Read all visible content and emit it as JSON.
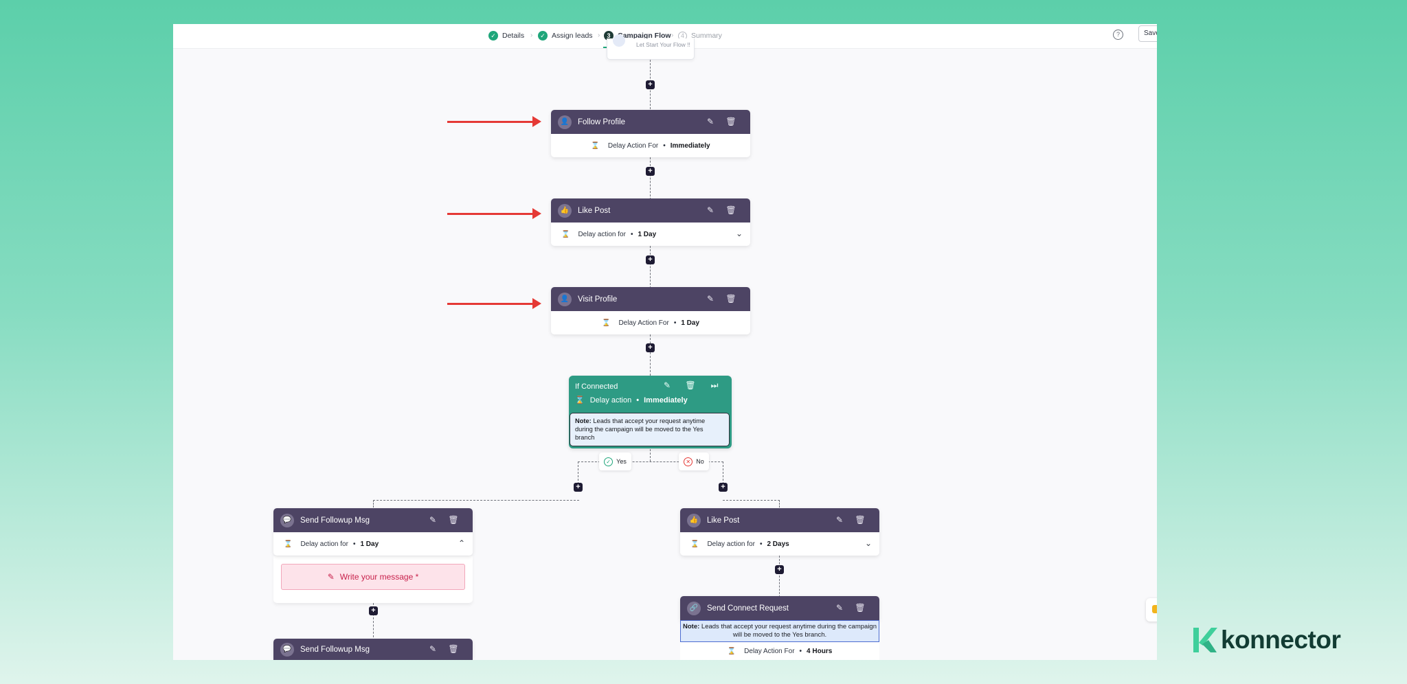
{
  "steps": [
    {
      "label": "Details",
      "state": "done"
    },
    {
      "label": "Assign leads",
      "state": "done"
    },
    {
      "label": "Campaign Flow",
      "state": "active",
      "number": "3"
    },
    {
      "label": "Summary",
      "state": "pending",
      "number": "4"
    }
  ],
  "toolbar": {
    "save_label": "Save",
    "help_icon": "?"
  },
  "start_node": {
    "text": "Let Start Your Flow !!"
  },
  "nodes": {
    "follow_profile": {
      "title": "Follow Profile",
      "delay_label": "Delay Action For",
      "delay_value": "Immediately"
    },
    "like_post": {
      "title": "Like Post",
      "delay_label": "Delay action for",
      "delay_value": "1 Day"
    },
    "visit_profile": {
      "title": "Visit Profile",
      "delay_label": "Delay Action For",
      "delay_value": "1 Day"
    },
    "if_connected": {
      "title": "If Connected",
      "delay_label": "Delay action",
      "delay_value": "Immediately",
      "note_bold": "Note:",
      "note_text": " Leads that accept your request anytime during the campaign will be moved to the Yes branch"
    },
    "yes_branch": {
      "label": "Yes"
    },
    "no_branch": {
      "label": "No"
    },
    "send_followup_1": {
      "title": "Send Followup Msg",
      "delay_label": "Delay action for",
      "delay_value": "1 Day",
      "message_placeholder": "Write your message *"
    },
    "send_followup_2": {
      "title": "Send Followup Msg"
    },
    "like_post_2": {
      "title": "Like Post",
      "delay_label": "Delay action for",
      "delay_value": "2 Days"
    },
    "send_connect_request": {
      "title": "Send Connect Request",
      "note_bold": "Note:",
      "note_text": " Leads that accept your request anytime during the campaign will be moved to the Yes branch.",
      "delay_label": "Delay Action For",
      "delay_value": "4 Hours"
    }
  },
  "brand": {
    "name": "konnector",
    "accent": "#3fcf9b",
    "dark": "#123c33"
  },
  "colors": {
    "node_header": "#4d4464",
    "condition": "#2e9b84",
    "plus": "#1e1b33",
    "arrow": "#e53935"
  }
}
